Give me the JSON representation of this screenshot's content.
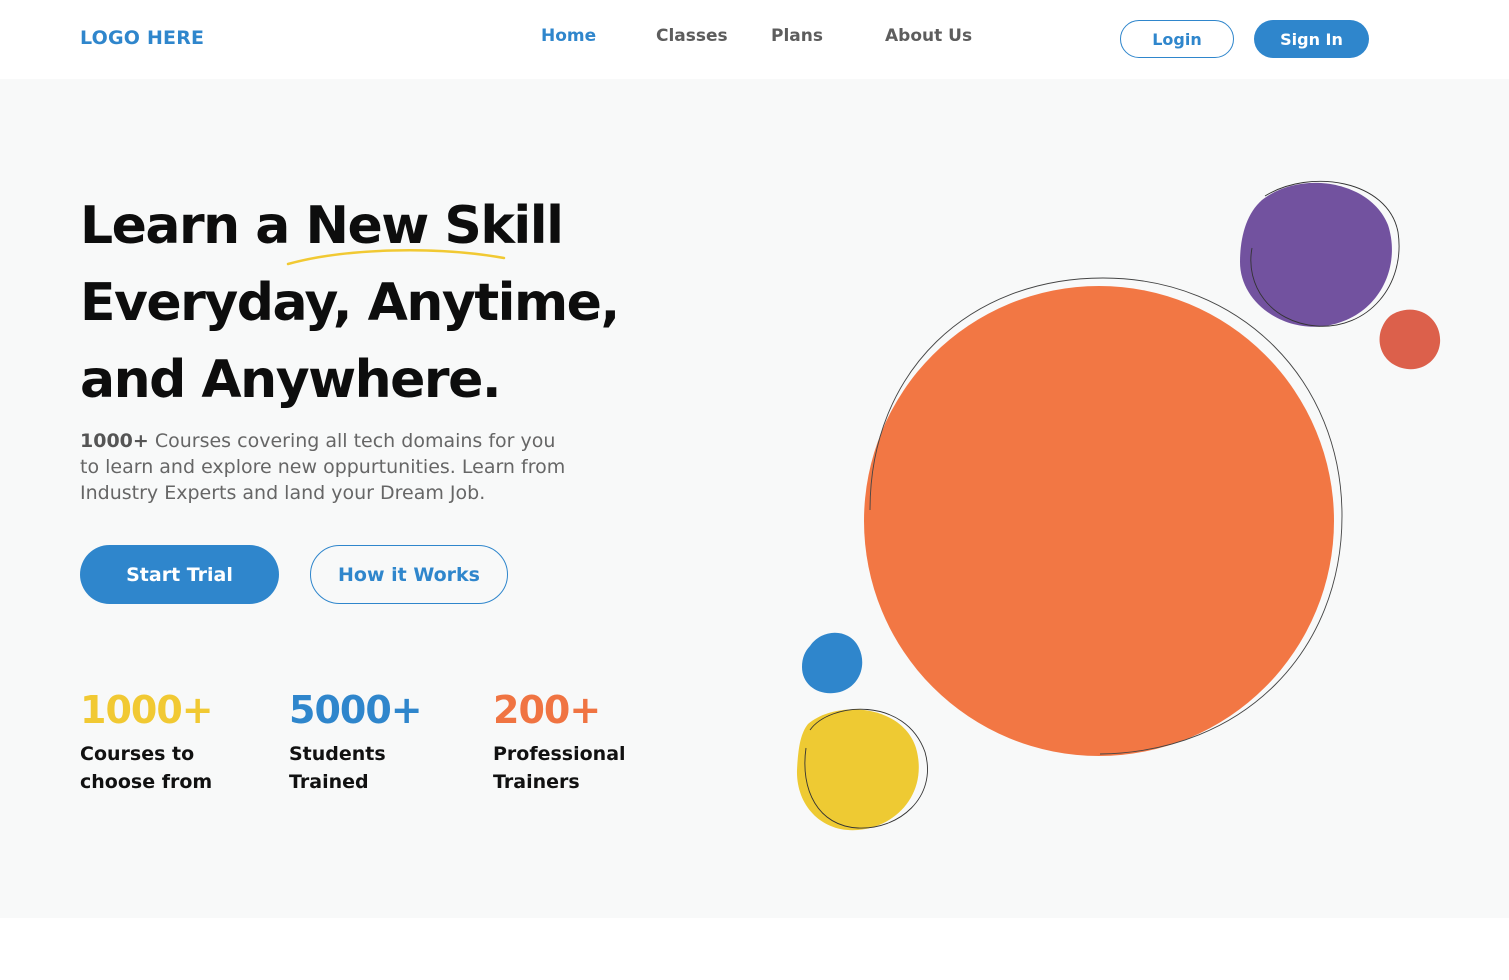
{
  "nav": {
    "logo": "LOGO HERE",
    "links": [
      "Home",
      "Classes",
      "Plans",
      "About Us"
    ],
    "active_link": "Home",
    "login_label": "Login",
    "signin_label": "Sign In"
  },
  "hero": {
    "headline_lines": [
      "Learn a New Skill",
      "Everyday, Anytime,",
      "and Anywhere."
    ],
    "description_bold": "1000+",
    "description_rest": " Courses covering all tech domains for you to learn and explore new oppurtunities. Learn from Industry Experts and land your Dream Job.",
    "primary_button": "Start Trial",
    "secondary_button": "How it Works"
  },
  "stats": [
    {
      "number": "1000+",
      "label_line1": "Courses to",
      "label_line2": "choose from",
      "color": "#f1c933"
    },
    {
      "number": "5000+",
      "label_line1": "Students",
      "label_line2": "Trained",
      "color": "#2f86cc"
    },
    {
      "number": "200+",
      "label_line1": "Professional",
      "label_line2": "Trainers",
      "color": "#f07442"
    }
  ],
  "colors": {
    "accent_blue": "#2f86cc",
    "orange": "#f27744",
    "purple": "#72529f",
    "red": "#dc604b",
    "yellow": "#eeca33",
    "underline_yellow": "#f1c933"
  }
}
